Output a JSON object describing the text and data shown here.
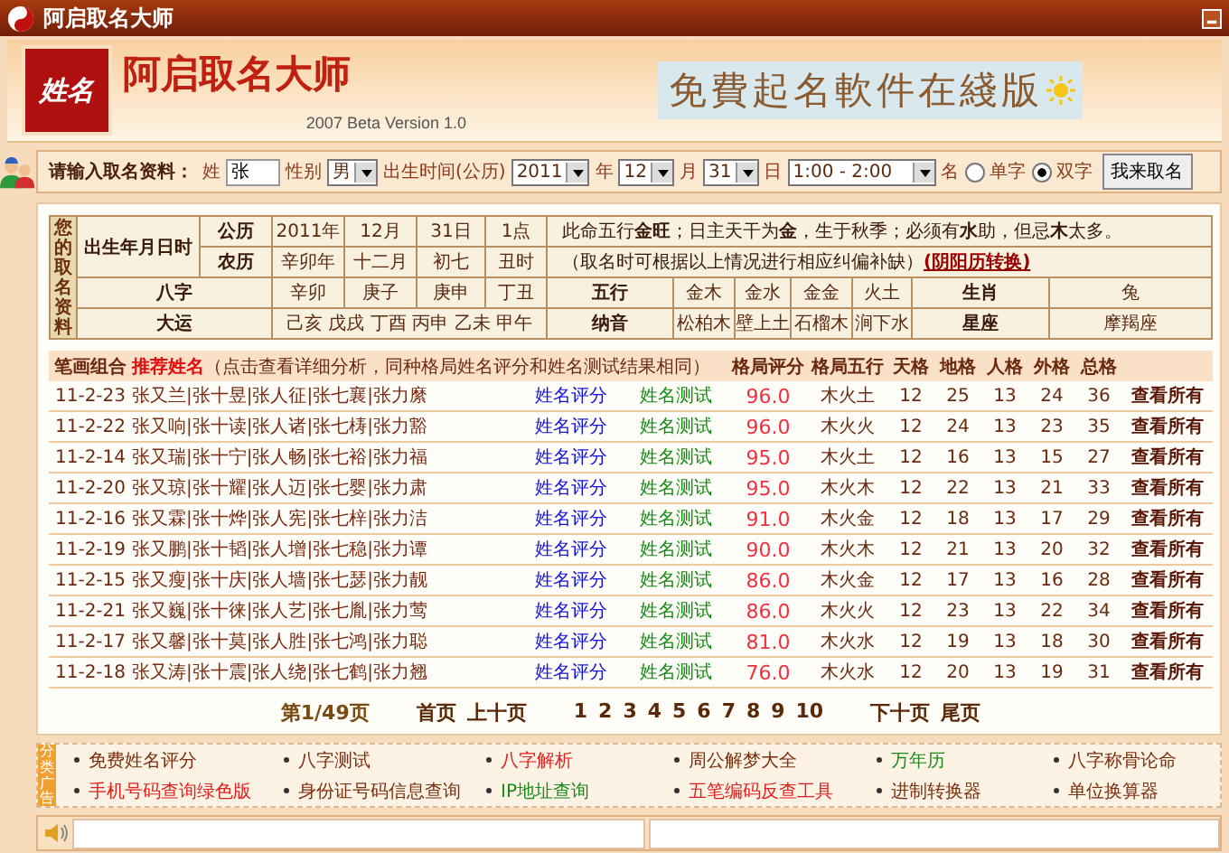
{
  "window": {
    "title": "阿启取名大师"
  },
  "header": {
    "logo_text": "姓名",
    "app_name": "阿启取名大师",
    "version": "2007 Beta Version 1.0",
    "banner": "免費起名軟件在綫版"
  },
  "form": {
    "label": "请输入取名资料：",
    "surname_label": "姓",
    "surname": "张",
    "gender_label": "性别",
    "gender": "男",
    "birth_label": "出生时间(公历)",
    "year": "2011",
    "year_unit": "年",
    "month": "12",
    "month_unit": "月",
    "day": "31",
    "day_unit": "日",
    "hour": "1:00 - 2:00",
    "name_label": "名",
    "options": [
      {
        "label": "单字",
        "selected": false
      },
      {
        "label": "双字",
        "selected": true
      }
    ],
    "submit": "我来取名"
  },
  "info": {
    "side_label": "您的取名资料",
    "birth_label": "出生年月日时",
    "solar": {
      "label": "公历",
      "values": [
        "2011年",
        "12月",
        "31日",
        "1点"
      ],
      "note": "此命五行**金旺**；日主天干为**金**，生于秋季；必须有**水**助，但忌**木**太多。"
    },
    "lunar": {
      "label": "农历",
      "values": [
        "辛卯年",
        "十二月",
        "初七",
        "丑时"
      ],
      "note": "（取名时可根据以上情况进行相应纠偏补缺）",
      "link": "(阴阳历转换)"
    },
    "bazi": {
      "label": "八字",
      "values": [
        "辛卯",
        "庚子",
        "庚申",
        "丁丑"
      ],
      "wuxing_label": "五行",
      "wuxing": [
        "金木",
        "金水",
        "金金",
        "火土"
      ],
      "zodiac_label": "生肖",
      "zodiac": "兔"
    },
    "dayun": {
      "label": "大运",
      "values": "己亥 戊戌 丁酉 丙申 乙未 甲午",
      "nayin_label": "纳音",
      "nayin": [
        "松柏木",
        "壁上土",
        "石榴木",
        "涧下水"
      ],
      "star_label": "星座",
      "star": "摩羯座"
    }
  },
  "list": {
    "columns": [
      "笔画组合",
      "推荐姓名",
      "（点击查看详细分析，同种格局姓名评分和姓名测试结果相同）",
      "格局评分",
      "格局五行",
      "天格",
      "地格",
      "人格",
      "外格",
      "总格"
    ],
    "rows": [
      {
        "code": "11-2-23",
        "names": "张又兰|张十昱|张人征|张七襄|张力縻",
        "score_link": "姓名评分",
        "test_link": "姓名测试",
        "score": "96.0",
        "wuxing": "木火土",
        "grids": [
          "12",
          "25",
          "13",
          "24",
          "36"
        ],
        "view": "查看所有"
      },
      {
        "code": "11-2-22",
        "names": "张又响|张十读|张人诸|张七梼|张力豁",
        "score_link": "姓名评分",
        "test_link": "姓名测试",
        "score": "96.0",
        "wuxing": "木火火",
        "grids": [
          "12",
          "24",
          "13",
          "23",
          "35"
        ],
        "view": "查看所有"
      },
      {
        "code": "11-2-14",
        "names": "张又瑞|张十宁|张人畅|张七裕|张力福",
        "score_link": "姓名评分",
        "test_link": "姓名测试",
        "score": "95.0",
        "wuxing": "木火土",
        "grids": [
          "12",
          "16",
          "13",
          "15",
          "27"
        ],
        "view": "查看所有"
      },
      {
        "code": "11-2-20",
        "names": "张又琼|张十耀|张人迈|张七婴|张力肃",
        "score_link": "姓名评分",
        "test_link": "姓名测试",
        "score": "95.0",
        "wuxing": "木火木",
        "grids": [
          "12",
          "22",
          "13",
          "21",
          "33"
        ],
        "view": "查看所有"
      },
      {
        "code": "11-2-16",
        "names": "张又霖|张十烨|张人宪|张七梓|张力洁",
        "score_link": "姓名评分",
        "test_link": "姓名测试",
        "score": "91.0",
        "wuxing": "木火金",
        "grids": [
          "12",
          "18",
          "13",
          "17",
          "29"
        ],
        "view": "查看所有"
      },
      {
        "code": "11-2-19",
        "names": "张又鹏|张十韬|张人增|张七稳|张力谭",
        "score_link": "姓名评分",
        "test_link": "姓名测试",
        "score": "90.0",
        "wuxing": "木火木",
        "grids": [
          "12",
          "21",
          "13",
          "20",
          "32"
        ],
        "view": "查看所有"
      },
      {
        "code": "11-2-15",
        "names": "张又瘦|张十庆|张人墙|张七瑟|张力靓",
        "score_link": "姓名评分",
        "test_link": "姓名测试",
        "score": "86.0",
        "wuxing": "木火金",
        "grids": [
          "12",
          "17",
          "13",
          "16",
          "28"
        ],
        "view": "查看所有"
      },
      {
        "code": "11-2-21",
        "names": "张又巍|张十徕|张人艺|张七胤|张力莺",
        "score_link": "姓名评分",
        "test_link": "姓名测试",
        "score": "86.0",
        "wuxing": "木火火",
        "grids": [
          "12",
          "23",
          "13",
          "22",
          "34"
        ],
        "view": "查看所有"
      },
      {
        "code": "11-2-17",
        "names": "张又馨|张十莫|张人胜|张七鸿|张力聪",
        "score_link": "姓名评分",
        "test_link": "姓名测试",
        "score": "81.0",
        "wuxing": "木火水",
        "grids": [
          "12",
          "19",
          "13",
          "18",
          "30"
        ],
        "view": "查看所有"
      },
      {
        "code": "11-2-18",
        "names": "张又涛|张十震|张人绕|张七鹤|张力翘",
        "score_link": "姓名评分",
        "test_link": "姓名测试",
        "score": "76.0",
        "wuxing": "木火水",
        "grids": [
          "12",
          "20",
          "13",
          "19",
          "31"
        ],
        "view": "查看所有"
      }
    ]
  },
  "pagination": {
    "status": "第1/49页",
    "first": "首页",
    "prev": "上十页",
    "pages": [
      "1",
      "2",
      "3",
      "4",
      "5",
      "6",
      "7",
      "8",
      "9",
      "10"
    ],
    "next": "下十页",
    "last": "尾页"
  },
  "ads": {
    "tab": "分类广告",
    "links": [
      {
        "label": "免费姓名评分",
        "color": "#7a2e0e"
      },
      {
        "label": "八字测试",
        "color": "#7a2e0e"
      },
      {
        "label": "八字解析",
        "color": "#e02020"
      },
      {
        "label": "周公解梦大全",
        "color": "#7a2e0e"
      },
      {
        "label": "万年历",
        "color": "#1a8a1a"
      },
      {
        "label": "八字称骨论命",
        "color": "#7a2e0e"
      },
      {
        "label": "手机号码查询绿色版",
        "color": "#e02020"
      },
      {
        "label": "身份证号码信息查询",
        "color": "#7a2e0e"
      },
      {
        "label": "IP地址查询",
        "color": "#1a8a1a"
      },
      {
        "label": "五笔编码反查工具",
        "color": "#e02020"
      },
      {
        "label": "进制转换器",
        "color": "#7a2e0e"
      },
      {
        "label": "单位换算器",
        "color": "#7a2e0e"
      }
    ]
  }
}
